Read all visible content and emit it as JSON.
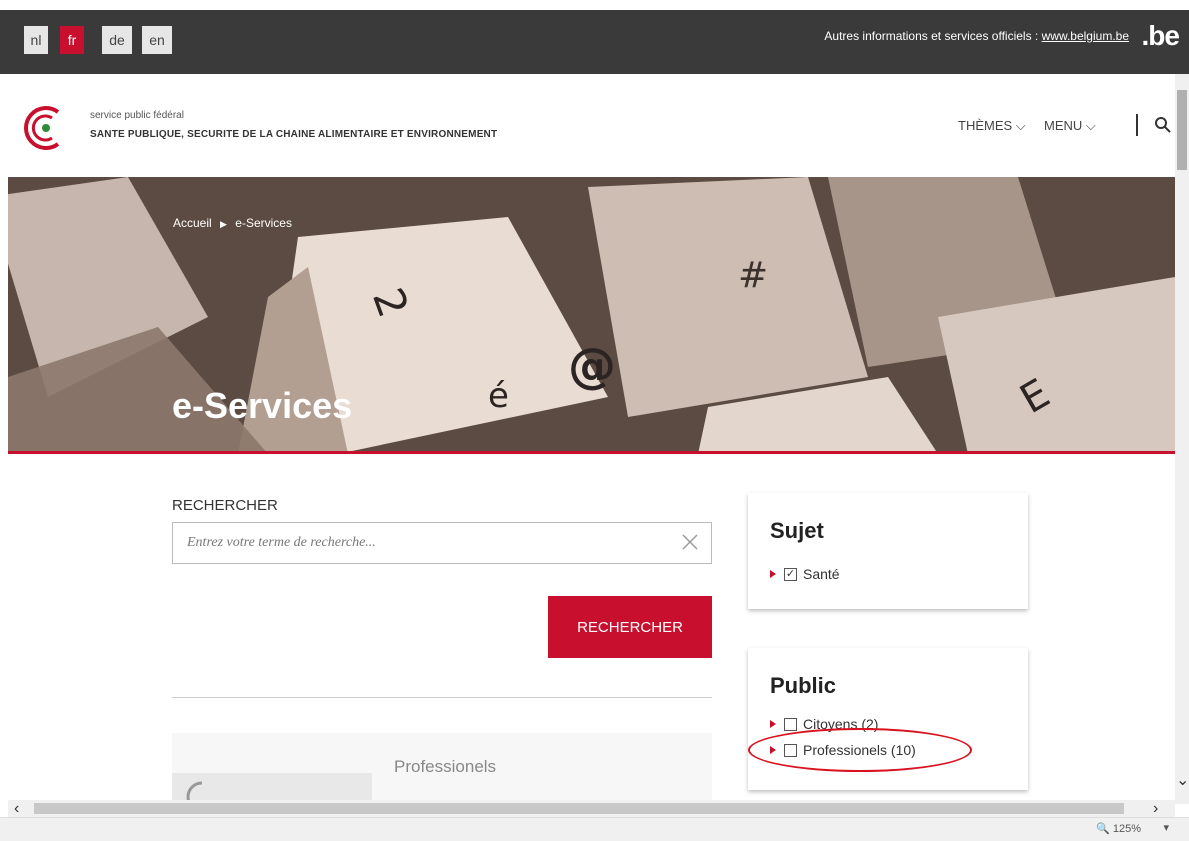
{
  "topbar": {
    "languages": [
      {
        "code": "nl",
        "active": false
      },
      {
        "code": "fr",
        "active": true
      },
      {
        "code": "de",
        "active": false
      },
      {
        "code": "en",
        "active": false
      }
    ],
    "official_text": "Autres informations et services officiels :",
    "official_link": "www.belgium.be",
    "brand": ".be"
  },
  "header": {
    "agency_line1": "service public fédéral",
    "agency_line2": "SANTE PUBLIQUE, SECURITE DE LA CHAINE ALIMENTAIRE ET ENVIRONNEMENT",
    "nav": {
      "themes": "THÈMES ⌵",
      "menu": "MENU ⌵"
    }
  },
  "hero": {
    "breadcrumb_home": "Accueil",
    "breadcrumb_sep": "▶",
    "breadcrumb_current": "e-Services",
    "title": "e-Services"
  },
  "search": {
    "label": "RECHERCHER",
    "placeholder": "Entrez votre terme de recherche...",
    "button": "RECHERCHER"
  },
  "result": {
    "category": "Professionels"
  },
  "filters": {
    "sujet": {
      "title": "Sujet",
      "items": [
        {
          "label": "Santé",
          "checked": true
        }
      ]
    },
    "public": {
      "title": "Public",
      "items": [
        {
          "label": "Citoyens (2)",
          "checked": false
        },
        {
          "label": "Professionels (10)",
          "checked": false
        }
      ]
    }
  },
  "statusbar": {
    "zoom": "125%"
  },
  "colors": {
    "accent": "#c8102e",
    "topbar": "#3a3a3a",
    "annotation": "#d8121e"
  }
}
